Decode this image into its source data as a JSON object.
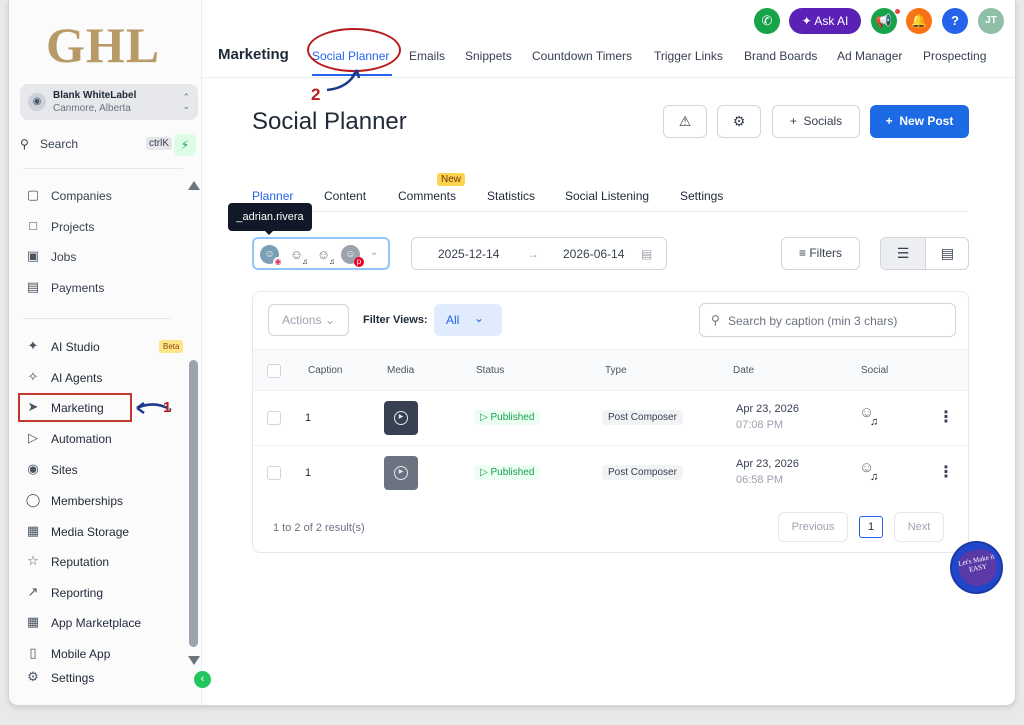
{
  "brand": {
    "logo_text": "GHL"
  },
  "account": {
    "name": "Blank WhiteLabel",
    "location": "Canmore, Alberta"
  },
  "sidebar_search": {
    "label": "Search",
    "shortcut": "ctrlK"
  },
  "sidebar": {
    "items": [
      {
        "label": "Companies",
        "icon": "building-icon"
      },
      {
        "label": "Projects",
        "icon": "folder-icon"
      },
      {
        "label": "Jobs",
        "icon": "briefcase-icon"
      },
      {
        "label": "Payments",
        "icon": "receipt-icon"
      },
      {
        "label": "AI Studio",
        "icon": "ai-studio-icon",
        "badge": "Beta"
      },
      {
        "label": "AI Agents",
        "icon": "sparkle-icon"
      },
      {
        "label": "Marketing",
        "icon": "send-icon"
      },
      {
        "label": "Automation",
        "icon": "automation-icon"
      },
      {
        "label": "Sites",
        "icon": "globe-icon"
      },
      {
        "label": "Memberships",
        "icon": "badge-icon"
      },
      {
        "label": "Media Storage",
        "icon": "image-icon"
      },
      {
        "label": "Reputation",
        "icon": "star-icon"
      },
      {
        "label": "Reporting",
        "icon": "chart-icon"
      },
      {
        "label": "App Marketplace",
        "icon": "grid-icon"
      },
      {
        "label": "Mobile App",
        "icon": "phone-icon"
      },
      {
        "label": "Settings",
        "icon": "gear-icon"
      }
    ]
  },
  "annotations": {
    "step1": "1",
    "step2": "2"
  },
  "header": {
    "section": "Marketing",
    "tabs": [
      "Social Planner",
      "Emails",
      "Snippets",
      "Countdown Timers",
      "Trigger Links",
      "Brand Boards",
      "Ad Manager",
      "Prospecting"
    ],
    "ask_ai": "Ask AI",
    "avatar_initials": "JT",
    "help": "?"
  },
  "page": {
    "title": "Social Planner",
    "socials_label": "Socials",
    "new_post_label": "New Post"
  },
  "subtabs": {
    "items": [
      "Planner",
      "Content",
      "Comments",
      "Statistics",
      "Social Listening",
      "Settings"
    ],
    "new_badge": "New"
  },
  "tooltip": "_adrian.rivera",
  "date_range": {
    "start": "2025-12-14",
    "end": "2026-06-14"
  },
  "filters_label": "Filters",
  "table": {
    "actions_label": "Actions",
    "filter_views_label": "Filter Views:",
    "filter_views_value": "All",
    "search_placeholder": "Search by caption (min 3 chars)",
    "columns": [
      "Caption",
      "Media",
      "Status",
      "Type",
      "Date",
      "Social"
    ],
    "rows": [
      {
        "caption": "1",
        "status": "Published",
        "type": "Post Composer",
        "date": "Apr 23, 2026",
        "time": "07:08 PM"
      },
      {
        "caption": "1",
        "status": "Published",
        "type": "Post Composer",
        "date": "Apr 23, 2026",
        "time": "06:58 PM"
      }
    ],
    "results": "1 to 2 of 2 result(s)",
    "previous": "Previous",
    "page": "1",
    "next": "Next"
  },
  "fab_text": "Let's Make it EASY",
  "colors": {
    "accent": "#1d6ae5",
    "annotation": "#b91c1c",
    "published": "#16a34a"
  }
}
